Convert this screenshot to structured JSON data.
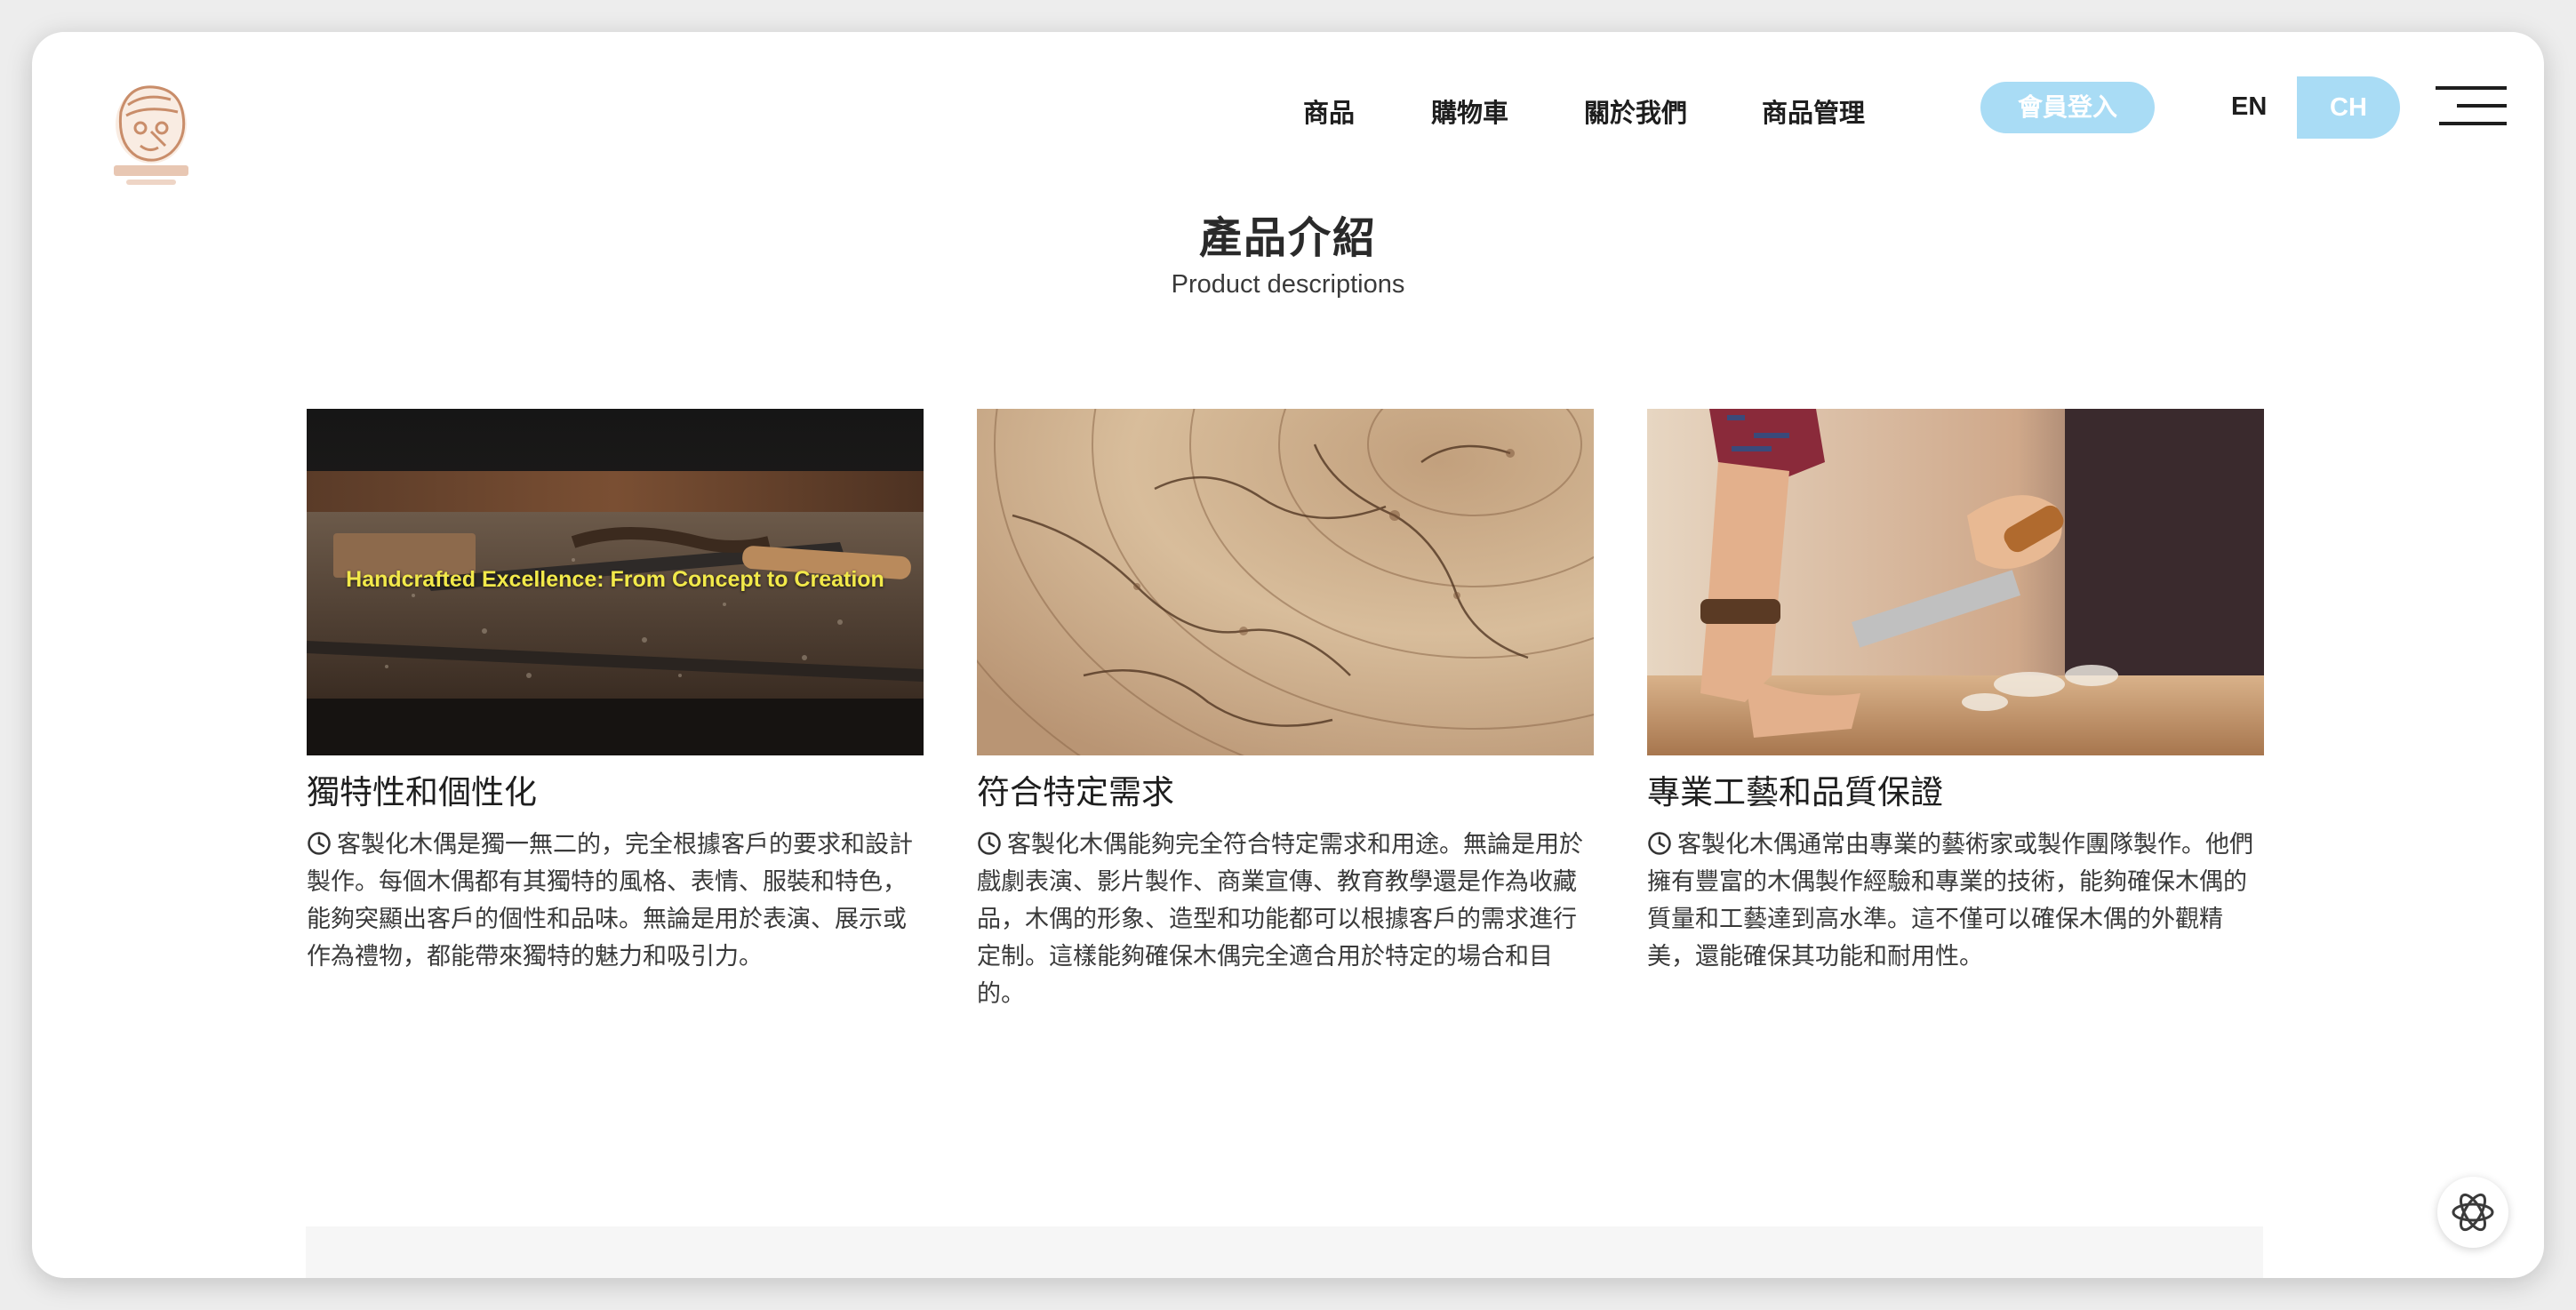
{
  "header": {
    "logo_icon": "puppet-logo-icon",
    "nav_items": [
      "商品",
      "購物車",
      "關於我們",
      "商品管理"
    ],
    "login_label": "會員登入",
    "lang_en": "EN",
    "lang_ch": "CH",
    "menu_icon": "hamburger-menu-icon",
    "accent_color": "#a9dcf5"
  },
  "section": {
    "title": "產品介紹",
    "subtitle": "Product descriptions"
  },
  "cards": [
    {
      "image_overlay": "Handcrafted Excellence: From Concept to Creation",
      "title": "獨特性和個性化",
      "desc": "客製化木偶是獨一無二的，完全根據客戶的要求和設計製作。每個木偶都有其獨特的風格、表情、服裝和特色，能夠突顯出客戶的個性和品味。無論是用於表演、展示或作為禮物，都能帶來獨特的魅力和吸引力。"
    },
    {
      "title": "符合特定需求",
      "desc": "客製化木偶能夠完全符合特定需求和用途。無論是用於戲劇表演、影片製作、商業宣傳、教育教學還是作為收藏品，木偶的形象、造型和功能都可以根據客戶的需求進行定制。這樣能夠確保木偶完全適合用於特定的場合和目的。"
    },
    {
      "title": "專業工藝和品質保證",
      "desc": "客製化木偶通常由專業的藝術家或製作團隊製作。他們擁有豐富的木偶製作經驗和專業的技術，能夠確保木偶的質量和工藝達到高水準。這不僅可以確保木偶的外觀精美，還能確保其功能和耐用性。"
    }
  ],
  "icons": {
    "clock": "clock-icon",
    "assistant": "assistant-icon"
  }
}
